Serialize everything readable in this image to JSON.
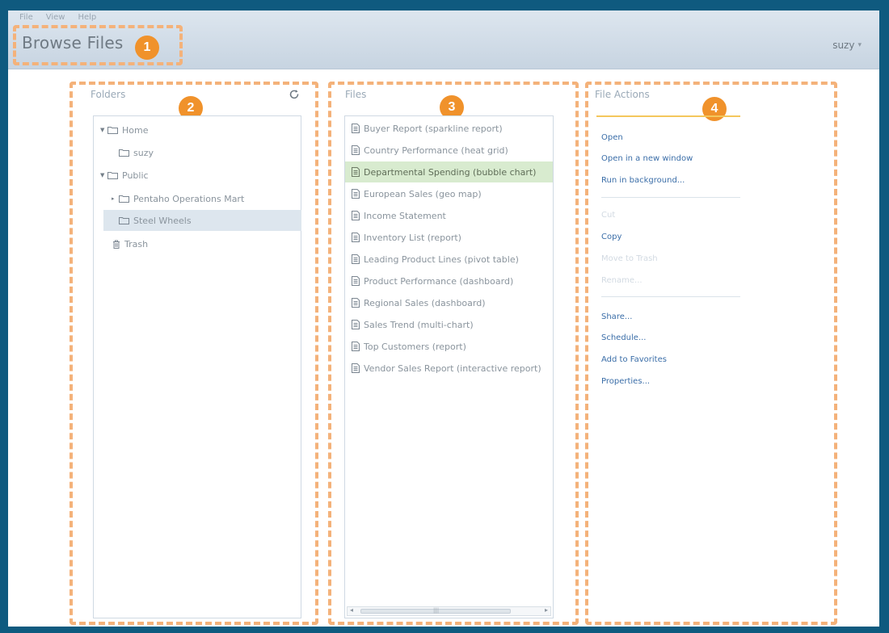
{
  "menu": [
    "File",
    "View",
    "Help"
  ],
  "header": {
    "title": "Browse Files",
    "user": "suzy"
  },
  "badges": [
    "1",
    "2",
    "3",
    "4"
  ],
  "folders": {
    "title": "Folders",
    "items": [
      {
        "label": "Home",
        "expanded": true
      },
      {
        "label": "suzy"
      },
      {
        "label": "Public",
        "expanded": true
      },
      {
        "label": "Pentaho Operations Mart",
        "collapsed": true
      },
      {
        "label": "Steel Wheels",
        "selected": true
      },
      {
        "label": "Trash"
      }
    ]
  },
  "files": {
    "title": "Files",
    "items": [
      "Buyer Report (sparkline report)",
      "Country Performance (heat grid)",
      "Departmental Spending (bubble chart)",
      "European Sales (geo map)",
      "Income Statement",
      "Inventory List (report)",
      "Leading Product Lines (pivot table)",
      "Product Performance (dashboard)",
      "Regional Sales (dashboard)",
      "Sales Trend (multi-chart)",
      "Top Customers (report)",
      "Vendor Sales Report (interactive report)"
    ],
    "selected_index": 2
  },
  "actions": {
    "title": "File Actions",
    "group1": [
      "Open",
      "Open in a new window",
      "Run in background..."
    ],
    "group2": [
      "Cut",
      "Copy",
      "Move to Trash",
      "Rename..."
    ],
    "group2_disabled": [
      true,
      false,
      true,
      true
    ],
    "group3": [
      "Share...",
      "Schedule...",
      "Add to Favorites",
      "Properties..."
    ]
  },
  "colors": {
    "accent": "#f0922b",
    "frame": "#0f5a7f",
    "link": "#3b6ea8",
    "selected_file": "#d8ebcf",
    "selected_folder": "#dde6ee"
  }
}
